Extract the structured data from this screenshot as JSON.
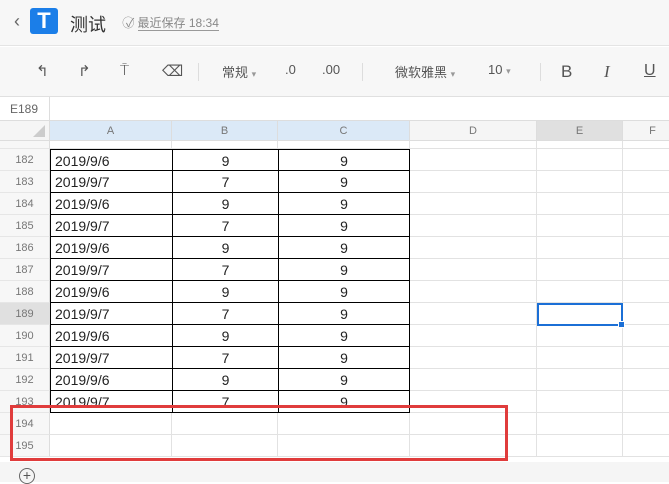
{
  "header": {
    "title": "测试",
    "save_status": "最近保存 18:34"
  },
  "toolbar": {
    "number_format": "常规",
    "decrease_decimal": ".0",
    "increase_decimal": ".00",
    "font": "微软雅黑",
    "font_size": "10",
    "bold": "B",
    "italic": "I",
    "underline": "U"
  },
  "formula": {
    "cell_ref": "E189"
  },
  "columns": [
    "A",
    "B",
    "C",
    "D",
    "E",
    "F"
  ],
  "rows": [
    {
      "n": "182",
      "a": "2019/9/6",
      "b": "9",
      "c": "9"
    },
    {
      "n": "183",
      "a": "2019/9/7",
      "b": "7",
      "c": "9"
    },
    {
      "n": "184",
      "a": "2019/9/6",
      "b": "9",
      "c": "9"
    },
    {
      "n": "185",
      "a": "2019/9/7",
      "b": "7",
      "c": "9"
    },
    {
      "n": "186",
      "a": "2019/9/6",
      "b": "9",
      "c": "9"
    },
    {
      "n": "187",
      "a": "2019/9/7",
      "b": "7",
      "c": "9"
    },
    {
      "n": "188",
      "a": "2019/9/6",
      "b": "9",
      "c": "9"
    },
    {
      "n": "189",
      "a": "2019/9/7",
      "b": "7",
      "c": "9"
    },
    {
      "n": "190",
      "a": "2019/9/6",
      "b": "9",
      "c": "9"
    },
    {
      "n": "191",
      "a": "2019/9/7",
      "b": "7",
      "c": "9"
    },
    {
      "n": "192",
      "a": "2019/9/6",
      "b": "9",
      "c": "9"
    },
    {
      "n": "193",
      "a": "2019/9/7",
      "b": "7",
      "c": "9"
    }
  ],
  "empty_rows": [
    "194",
    "195"
  ],
  "colors": {
    "accent": "#1b6fd6",
    "highlight": "#e03c3c"
  }
}
